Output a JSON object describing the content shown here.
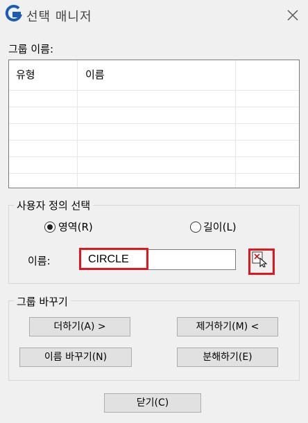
{
  "window": {
    "title": "선택 매니저"
  },
  "group_name_label": "그룹 이름:",
  "group_table": {
    "columns": [
      "유형",
      "이름"
    ]
  },
  "custom_selection": {
    "legend": "사용자 정의 선택",
    "radio_area": "영역(R)",
    "radio_length": "길이(L)",
    "selected": "영역(R)",
    "name_label": "이름:",
    "name_value": "CIRCLE"
  },
  "group_change": {
    "legend": "그룹 바꾸기",
    "add": "더하기(A) >",
    "remove": "제거하기(M) <",
    "rename": "이름 바꾸기(N)",
    "explode": "분해하기(E)"
  },
  "close_button": "닫기(C)",
  "colors": {
    "highlight": "#e0161c",
    "icon_blue": "#1a5bb8"
  },
  "icons": {
    "app": "gstarcad-logo-icon",
    "close": "close-icon",
    "pick": "select-object-icon"
  }
}
